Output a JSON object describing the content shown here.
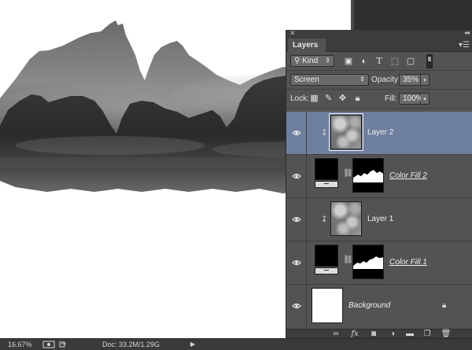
{
  "status": {
    "zoom": "16.67%",
    "doc": "Doc: 33.2M/1.29G"
  },
  "panel": {
    "tab_label": "Layers",
    "filter_kind": "Kind",
    "blend_mode": "Screen",
    "opacity_label": "Opacity:",
    "opacity_value": "35%",
    "lock_label": "Lock:",
    "fill_label": "Fill:",
    "fill_value": "100%"
  },
  "layers": [
    {
      "name": "Layer 2",
      "selected": true,
      "type": "clipped-pixel"
    },
    {
      "name": "Color Fill 2",
      "selected": false,
      "type": "fill-with-mask"
    },
    {
      "name": "Layer 1",
      "selected": false,
      "type": "clipped-pixel"
    },
    {
      "name": "Color Fill 1",
      "selected": false,
      "type": "fill-with-mask"
    },
    {
      "name": "Background",
      "selected": false,
      "type": "background",
      "locked": true
    }
  ],
  "icons": {
    "filter_icons": [
      "image-filter-icon",
      "adjustment-filter-icon",
      "type-filter-icon",
      "shape-filter-icon",
      "smart-object-filter-icon"
    ],
    "lock_icons": [
      "lock-transparent-pixels-icon",
      "lock-image-pixels-icon",
      "lock-position-icon",
      "lock-all-icon"
    ],
    "footer_icons": [
      "link-layers-icon",
      "layer-style-icon",
      "add-mask-icon",
      "new-adjustment-icon",
      "new-group-icon",
      "new-layer-icon",
      "delete-layer-icon"
    ]
  },
  "colors": {
    "panel_bg": "#535353",
    "selected_row": "#6f7f9e",
    "chrome_dark": "#3c3c3c"
  }
}
